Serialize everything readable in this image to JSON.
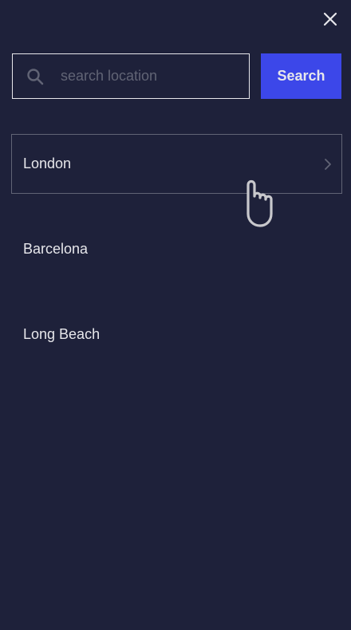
{
  "search": {
    "placeholder": "search location",
    "value": "",
    "button_label": "Search"
  },
  "results": [
    {
      "label": "London",
      "active": true
    },
    {
      "label": "Barcelona",
      "active": false
    },
    {
      "label": "Long Beach",
      "active": false
    }
  ],
  "colors": {
    "background": "#1e213a",
    "accent": "#3c47e9",
    "text": "#e7e7eb",
    "muted": "#616475"
  },
  "icons": {
    "close": "close-icon",
    "search": "search-icon",
    "chevron": "chevron-right-icon",
    "cursor": "hand-pointer-icon"
  }
}
